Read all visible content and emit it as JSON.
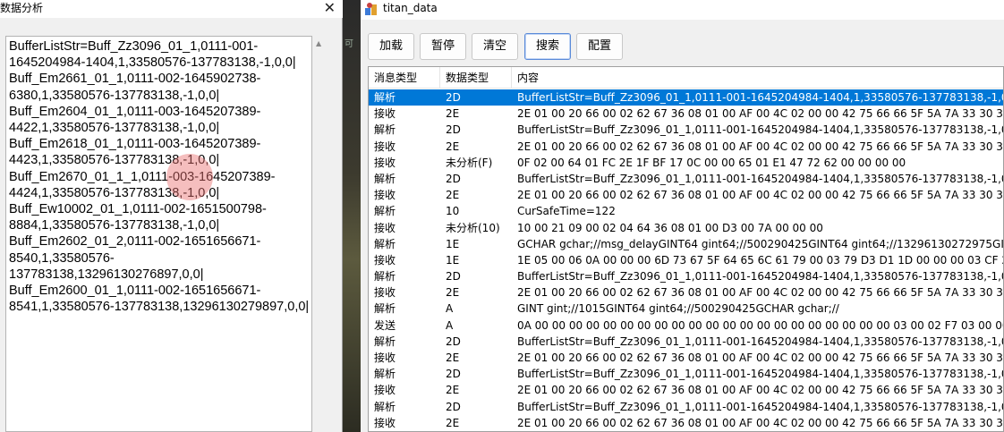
{
  "left_window": {
    "title": "数据分析",
    "close_label": "✕",
    "lines": [
      "BufferListStr=Buff_Zz3096_01_1,0111-001-",
      "1645204984-1404,1,33580576-137783138,-1,0,0|",
      "Buff_Em2661_01_1,0111-002-1645902738-",
      "6380,1,33580576-137783138,-1,0,0|",
      "Buff_Em2604_01_1,0111-003-1645207389-",
      "4422,1,33580576-137783138,-1,0,0|",
      "Buff_Em2618_01_1,0111-003-1645207389-",
      "4423,1,33580576-137783138,-1,0,0|",
      "Buff_Em2670_01_1_1,0111-003-1645207389-",
      "4424,1,33580576-137783138,-1,0,0|",
      "Buff_Ew10002_01_1,0111-002-1651500798-",
      "8884,1,33580576-137783138,-1,0,0|",
      "Buff_Em2602_01_2,0111-002-1651656671-",
      "8540,1,33580576-",
      "137783138,13296130276897,0,0|",
      "Buff_Em2600_01_1,0111-002-1651656671-",
      "8541,1,33580576-137783138,13296130279897,0,0|"
    ]
  },
  "right_window": {
    "title": "titan_data",
    "toolbar": {
      "load": "加载",
      "pause": "暂停",
      "clear": "清空",
      "search": "搜索",
      "config": "配置"
    },
    "table": {
      "headers": [
        "消息类型",
        "数据类型",
        "内容"
      ],
      "selected_index": 0,
      "rows": [
        [
          "解析",
          "2D",
          "BufferListStr=Buff_Zz3096_01_1,0111-001-1645204984-1404,1,33580576-137783138,-1,0,0|Buf"
        ],
        [
          "接收",
          "2E",
          "2E 01 00 20 66 00 02 62 67 36 08 01 00 AF 00 4C 02 00 00 42 75 66 66 5F 5A 7A 33 30 39 36 5"
        ],
        [
          "解析",
          "2D",
          "BufferListStr=Buff_Zz3096_01_1,0111-001-1645204984-1404,1,33580576-137783138,-1,0,0|Buf"
        ],
        [
          "接收",
          "2E",
          "2E 01 00 20 66 00 02 62 67 36 08 01 00 AF 00 4C 02 00 00 42 75 66 66 5F 5A 7A 33 30 39 36 5"
        ],
        [
          "接收",
          "未分析(F)",
          "0F 02 00 64 01 FC 2E 1F BF 17 0C 00 00 65 01 E1 47 72 62 00 00 00 00"
        ],
        [
          "解析",
          "2D",
          "BufferListStr=Buff_Zz3096_01_1,0111-001-1645204984-1404,1,33580576-137783138,-1,0,0|Buf"
        ],
        [
          "接收",
          "2E",
          "2E 01 00 20 66 00 02 62 67 36 08 01 00 AF 00 4C 02 00 00 42 75 66 66 5F 5A 7A 33 30 39 36 5"
        ],
        [
          "解析",
          "10",
          "CurSafeTime=122"
        ],
        [
          "接收",
          "未分析(10)",
          "10 00 21 09 00 02 04 64 36 08 01 00 D3 00 7A 00 00 00"
        ],
        [
          "解析",
          "1E",
          "GCHAR gchar;//msg_delayGINT64 gint64;//500290425GINT64 gint64;//13296130272975GINT64 g"
        ],
        [
          "接收",
          "1E",
          "1E 05 00 06 0A 00 00 00 6D 73 67 5F 64 65 6C 61 79 00 03 79 D3 D1 1D 00 00 00 03 CF 2E"
        ],
        [
          "解析",
          "2D",
          "BufferListStr=Buff_Zz3096_01_1,0111-001-1645204984-1404,1,33580576-137783138,-1,0,0|Buf"
        ],
        [
          "接收",
          "2E",
          "2E 01 00 20 66 00 02 62 67 36 08 01 00 AF 00 4C 02 00 00 42 75 66 66 5F 5A 7A 33 30 39 36 5"
        ],
        [
          "解析",
          "A",
          "GINT gint;//1015GINT64 gint64;//500290425GCHAR gchar;//"
        ],
        [
          "发送",
          "A",
          "0A 00 00 00 00 00 00 00 00 00 00 00 00 00 00 00 00 00 00 00 00 00 03 00 02 F7 03 00 00 03 79 D"
        ],
        [
          "解析",
          "2D",
          "BufferListStr=Buff_Zz3096_01_1,0111-001-1645204984-1404,1,33580576-137783138,-1,0,0|Buf"
        ],
        [
          "接收",
          "2E",
          "2E 01 00 20 66 00 02 62 67 36 08 01 00 AF 00 4C 02 00 00 42 75 66 66 5F 5A 7A 33 30 39 36 5"
        ],
        [
          "解析",
          "2D",
          "BufferListStr=Buff_Zz3096_01_1,0111-001-1645204984-1404,1,33580576-137783138,-1,0,0|Buf"
        ],
        [
          "接收",
          "2E",
          "2E 01 00 20 66 00 02 62 67 36 08 01 00 AF 00 4C 02 00 00 42 75 66 66 5F 5A 7A 33 30 39 36 5"
        ],
        [
          "解析",
          "2D",
          "BufferListStr=Buff_Zz3096_01_1,0111-001-1645204984-1404,1,33580576-137783138,-1,0,0|Buf"
        ],
        [
          "接收",
          "2E",
          "2E 01 00 20 66 00 02 62 67 36 08 01 00 AF 00 4C 02 00 00 42 75 66 66 5F 5A 7A 33 30 39 36 5"
        ]
      ]
    }
  },
  "background": {
    "partial_text": "可"
  },
  "colors": {
    "selection": "#0078d7",
    "window_bg": "#f0f0f0",
    "cursor_highlight": "#e86e6e"
  },
  "icons": {
    "app_icon": "titan-app-icon",
    "close": "close-icon",
    "scroll_up": "scroll-up-arrow-icon"
  }
}
